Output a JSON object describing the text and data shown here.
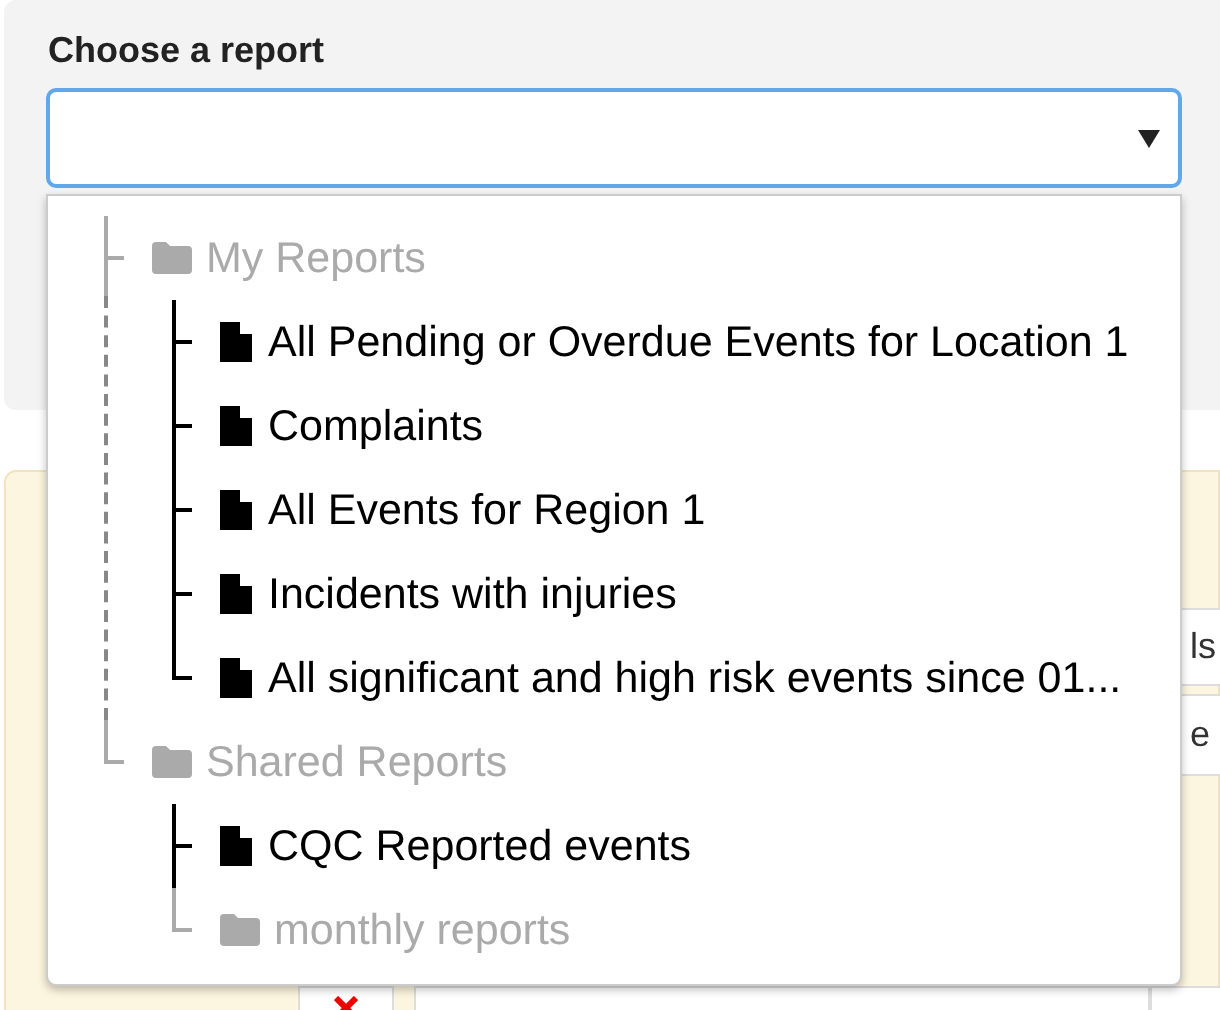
{
  "report_picker": {
    "label": "Choose a report",
    "value_field": {
      "expanded": true
    },
    "tree": [
      {
        "kind": "folder",
        "label": "My Reports",
        "children": [
          {
            "kind": "file",
            "label": "All Pending or Overdue Events for Location 1"
          },
          {
            "kind": "file",
            "label": "Complaints"
          },
          {
            "kind": "file",
            "label": "All Events for Region 1"
          },
          {
            "kind": "file",
            "label": "Incidents with injuries"
          },
          {
            "kind": "file",
            "label": "All significant and high risk events since 01..."
          }
        ]
      },
      {
        "kind": "folder",
        "label": "Shared Reports",
        "children": [
          {
            "kind": "file",
            "label": "CQC Reported events"
          },
          {
            "kind": "folder",
            "label": "monthly reports"
          }
        ]
      }
    ]
  },
  "background_form": {
    "column_3_texts": [
      "ls",
      "e"
    ]
  }
}
